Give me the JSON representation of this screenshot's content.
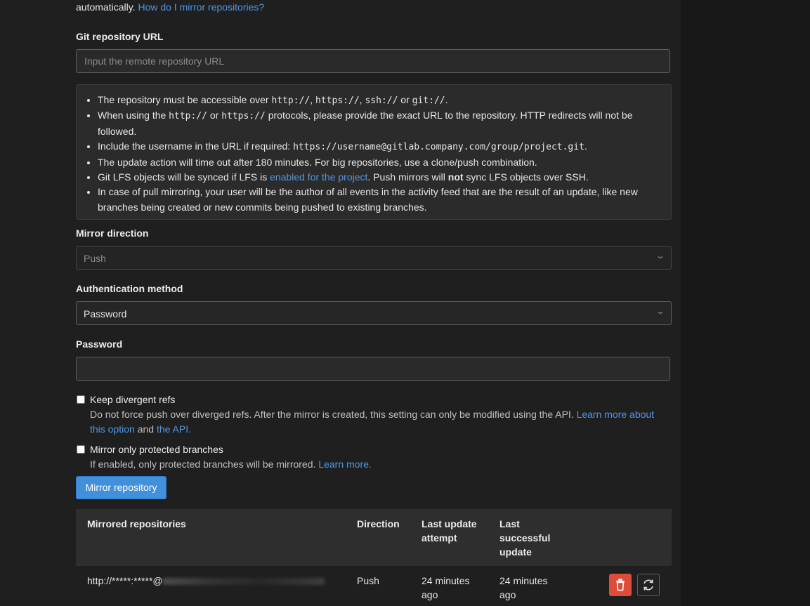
{
  "intro": {
    "text": "automatically.",
    "link": "How do I mirror repositories?"
  },
  "git_url": {
    "label": "Git repository URL",
    "placeholder": "Input the remote repository URL"
  },
  "info_list": {
    "item1": {
      "text1": "The repository must be accessible over ",
      "code1": "http://",
      "sep1": ", ",
      "code2": "https://",
      "sep2": ", ",
      "code3": "ssh://",
      "sep3": " or ",
      "code4": "git://",
      "end": "."
    },
    "item2": {
      "text1": "When using the ",
      "code1": "http://",
      "sep1": " or ",
      "code2": "https://",
      "text2": " protocols, please provide the exact URL to the repository. HTTP redirects will not be followed."
    },
    "item3": {
      "text1": "Include the username in the URL if required: ",
      "code1": "https://username@gitlab.company.com/group/project.git",
      "end": "."
    },
    "item4": {
      "text": "The update action will time out after 180 minutes. For big repositories, use a clone/push combination."
    },
    "item5": {
      "text1": "Git LFS objects will be synced if LFS is ",
      "link": "enabled for the project",
      "text2": ". Push mirrors will ",
      "bold": "not",
      "text3": " sync LFS objects over SSH."
    },
    "item6": {
      "text": "In case of pull mirroring, your user will be the author of all events in the activity feed that are the result of an update, like new branches being created or new commits being pushed to existing branches."
    }
  },
  "mirror_direction": {
    "label": "Mirror direction",
    "value": "Push"
  },
  "auth_method": {
    "label": "Authentication method",
    "value": "Password"
  },
  "password": {
    "label": "Password",
    "value": ""
  },
  "keep_divergent": {
    "label": "Keep divergent refs",
    "checked": false,
    "help": "Do not force push over diverged refs. After the mirror is created, this setting can only be modified using the API.",
    "link1": "Learn more about this option",
    "and": "and",
    "link2": "the API."
  },
  "protected_only": {
    "label": "Mirror only protected branches",
    "checked": false,
    "help": "If enabled, only protected branches will be mirrored.",
    "link": "Learn more."
  },
  "mirror_button": "Mirror repository",
  "table": {
    "headers": {
      "repo": "Mirrored repositories",
      "direction": "Direction",
      "last_attempt": "Last update attempt",
      "last_success": "Last successful update"
    },
    "rows": [
      {
        "url": "http://*****:*****@",
        "direction": "Push",
        "last_attempt": "24 minutes ago",
        "last_success": "24 minutes ago"
      }
    ]
  },
  "colors": {
    "accent": "#428fdc",
    "danger": "#dd4b39",
    "link": "#4f97e3"
  },
  "icons": {
    "select_caret": "chevron-down-icon",
    "delete": "trash-icon",
    "update": "sync-icon"
  }
}
